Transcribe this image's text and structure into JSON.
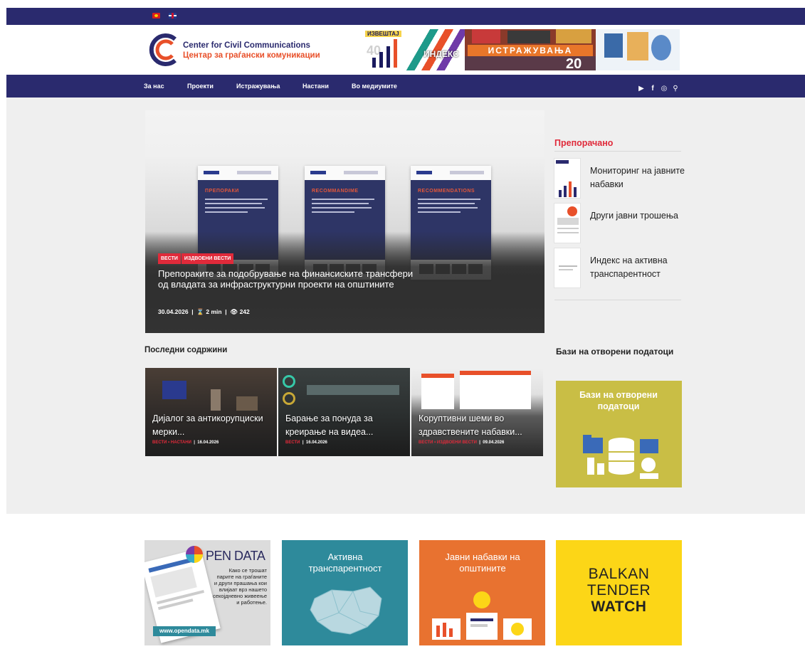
{
  "topbar": {
    "flags": [
      "mk-flag-icon",
      "uk-flag-icon"
    ]
  },
  "header": {
    "logo_line1": "Center for Civil Communications",
    "logo_line2": "Центар за граѓански комуникации",
    "banner": {
      "tag": "ИЗВЕШТАЈ",
      "number_left": "40",
      "index_word": "ИНДЕКС",
      "research_word": "ИСТРАЖУВАЊА",
      "number_right": "20"
    }
  },
  "nav": {
    "items": [
      "За нас",
      "Проекти",
      "Истражувања",
      "Настани",
      "Во медиумите"
    ],
    "icons": [
      "youtube-icon",
      "facebook-icon",
      "instagram-icon",
      "search-icon"
    ],
    "icon_glyphs": [
      "▶",
      "f",
      "◎",
      "⚲"
    ]
  },
  "hero": {
    "badges": [
      "ВЕСТИ",
      "ИЗДВОЕНИ ВЕСТИ"
    ],
    "doc_titles": [
      "ПРЕПОРАКИ",
      "RECOMMANDIME",
      "RECOMMENDATIONS"
    ],
    "title": "Препораките за подобрување на финансиските трансфери од владата за инфраструктурни проекти на општините",
    "date": "30.04.2026",
    "read_time": "2 min",
    "views": "242"
  },
  "recommended": {
    "heading": "Препорачано",
    "items": [
      {
        "label": "Мониторинг на јавните набавки"
      },
      {
        "label": "Други јавни трошења"
      },
      {
        "label": "Индекс на активна транспарентност"
      }
    ]
  },
  "latest": {
    "heading": "Последни содржини",
    "cards": [
      {
        "title": "Дијалог за антикорупциски мерки...",
        "category": "ВЕСТИ • НАСТАНИ",
        "date": "16.04.2026"
      },
      {
        "title": "Барање за понуда за креирање на видеа...",
        "category": "ВЕСТИ",
        "date": "16.04.2026"
      },
      {
        "title": "Коруптивни шеми во здравствените набавки...",
        "category": "ВЕСТИ • ИЗДВОЕНИ ВЕСТИ",
        "date": "09.04.2026"
      }
    ]
  },
  "open_data": {
    "heading": "Бази на отворени податоци",
    "box_text": "Бази на отворени податоци"
  },
  "tiles": {
    "opendata": {
      "logo_text": "PEN DATA",
      "text": "Како се трошат парите на граѓаните и други прашања кои влијаат врз нашето секојдневно живеење и работење.",
      "url": "www.opendata.mk"
    },
    "active_transparency": "Активна транспарентност",
    "municipal_procurement": "Јавни набавки на општините",
    "balkan": {
      "line1": "BALKAN",
      "line2": "TENDER",
      "line3": "WATCH"
    }
  },
  "colors": {
    "navy": "#2a2a6e",
    "accent_red": "#e02a3a",
    "orange": "#e8502a",
    "open_data_yellow": "#c9be45",
    "teal": "#2e8a9b",
    "tile_orange": "#e87230",
    "balkan_yellow": "#fcd617"
  }
}
